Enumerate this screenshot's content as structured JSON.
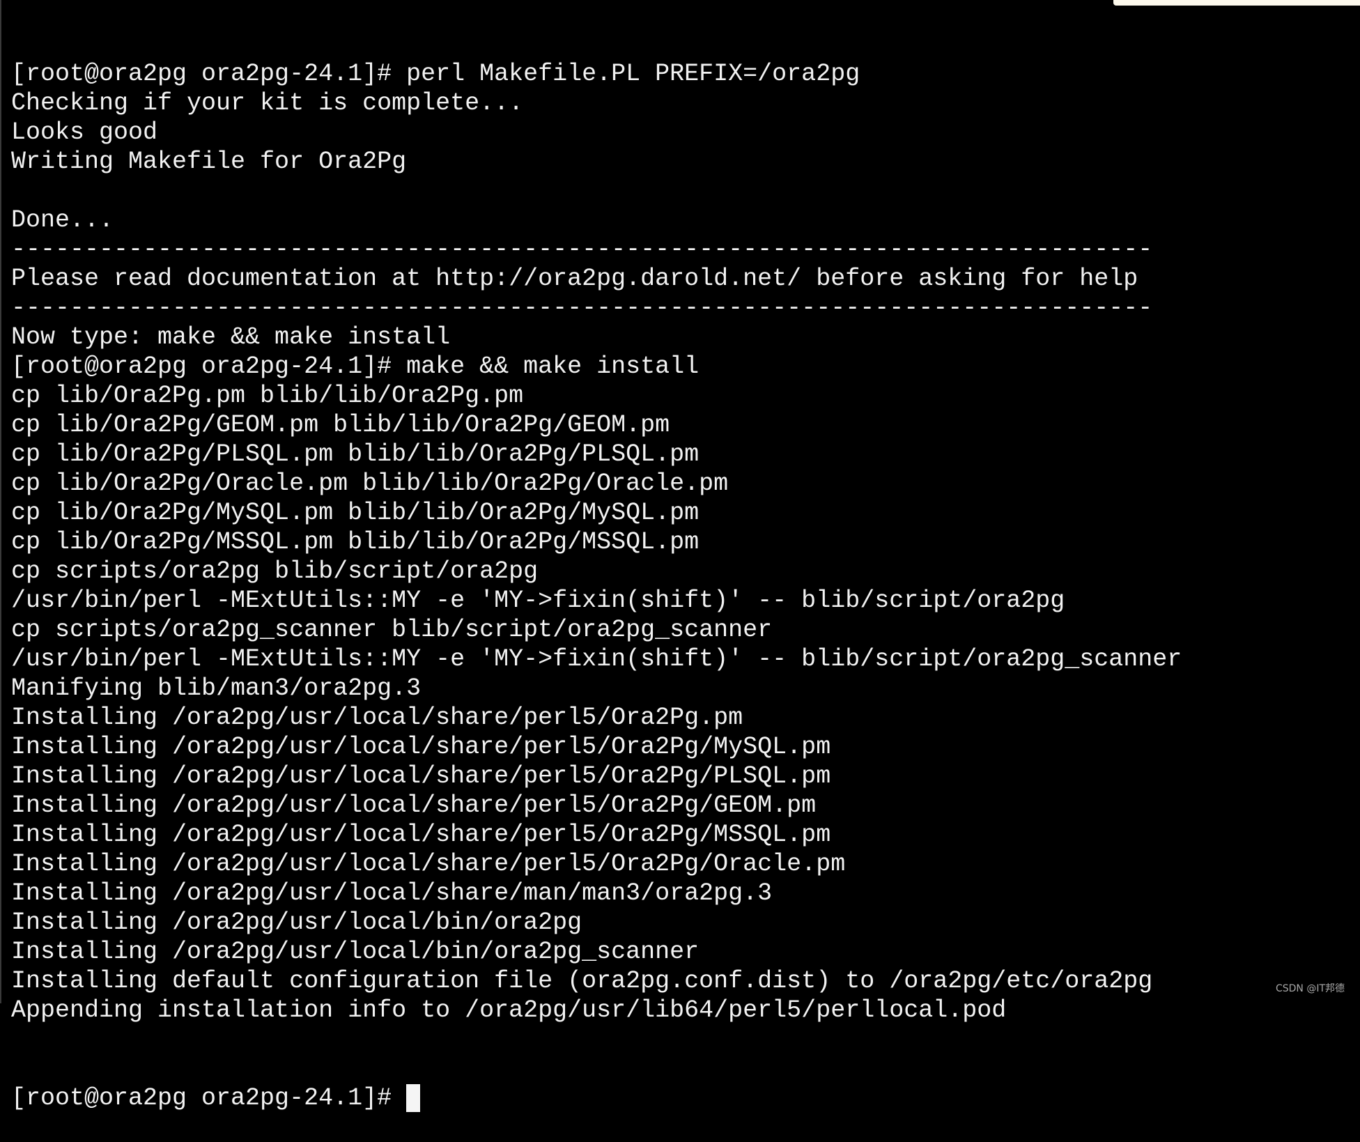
{
  "terminal": {
    "lines": [
      "[root@ora2pg ora2pg-24.1]# perl Makefile.PL PREFIX=/ora2pg",
      "Checking if your kit is complete...",
      "Looks good",
      "Writing Makefile for Ora2Pg",
      "",
      "Done...",
      "------------------------------------------------------------------------------",
      "Please read documentation at http://ora2pg.darold.net/ before asking for help",
      "------------------------------------------------------------------------------",
      "Now type: make && make install",
      "[root@ora2pg ora2pg-24.1]# make && make install",
      "cp lib/Ora2Pg.pm blib/lib/Ora2Pg.pm",
      "cp lib/Ora2Pg/GEOM.pm blib/lib/Ora2Pg/GEOM.pm",
      "cp lib/Ora2Pg/PLSQL.pm blib/lib/Ora2Pg/PLSQL.pm",
      "cp lib/Ora2Pg/Oracle.pm blib/lib/Ora2Pg/Oracle.pm",
      "cp lib/Ora2Pg/MySQL.pm blib/lib/Ora2Pg/MySQL.pm",
      "cp lib/Ora2Pg/MSSQL.pm blib/lib/Ora2Pg/MSSQL.pm",
      "cp scripts/ora2pg blib/script/ora2pg",
      "/usr/bin/perl -MExtUtils::MY -e 'MY->fixin(shift)' -- blib/script/ora2pg",
      "cp scripts/ora2pg_scanner blib/script/ora2pg_scanner",
      "/usr/bin/perl -MExtUtils::MY -e 'MY->fixin(shift)' -- blib/script/ora2pg_scanner",
      "Manifying blib/man3/ora2pg.3",
      "Installing /ora2pg/usr/local/share/perl5/Ora2Pg.pm",
      "Installing /ora2pg/usr/local/share/perl5/Ora2Pg/MySQL.pm",
      "Installing /ora2pg/usr/local/share/perl5/Ora2Pg/PLSQL.pm",
      "Installing /ora2pg/usr/local/share/perl5/Ora2Pg/GEOM.pm",
      "Installing /ora2pg/usr/local/share/perl5/Ora2Pg/MSSQL.pm",
      "Installing /ora2pg/usr/local/share/perl5/Ora2Pg/Oracle.pm",
      "Installing /ora2pg/usr/local/share/man/man3/ora2pg.3",
      "Installing /ora2pg/usr/local/bin/ora2pg",
      "Installing /ora2pg/usr/local/bin/ora2pg_scanner",
      "Installing default configuration file (ora2pg.conf.dist) to /ora2pg/etc/ora2pg",
      "Appending installation info to /ora2pg/usr/lib64/perl5/perllocal.pod"
    ],
    "prompt": "[root@ora2pg ora2pg-24.1]# ",
    "colors": {
      "background": "#000000",
      "foreground": "#f2f2f2"
    }
  },
  "watermark": "CSDN @IT邦德"
}
